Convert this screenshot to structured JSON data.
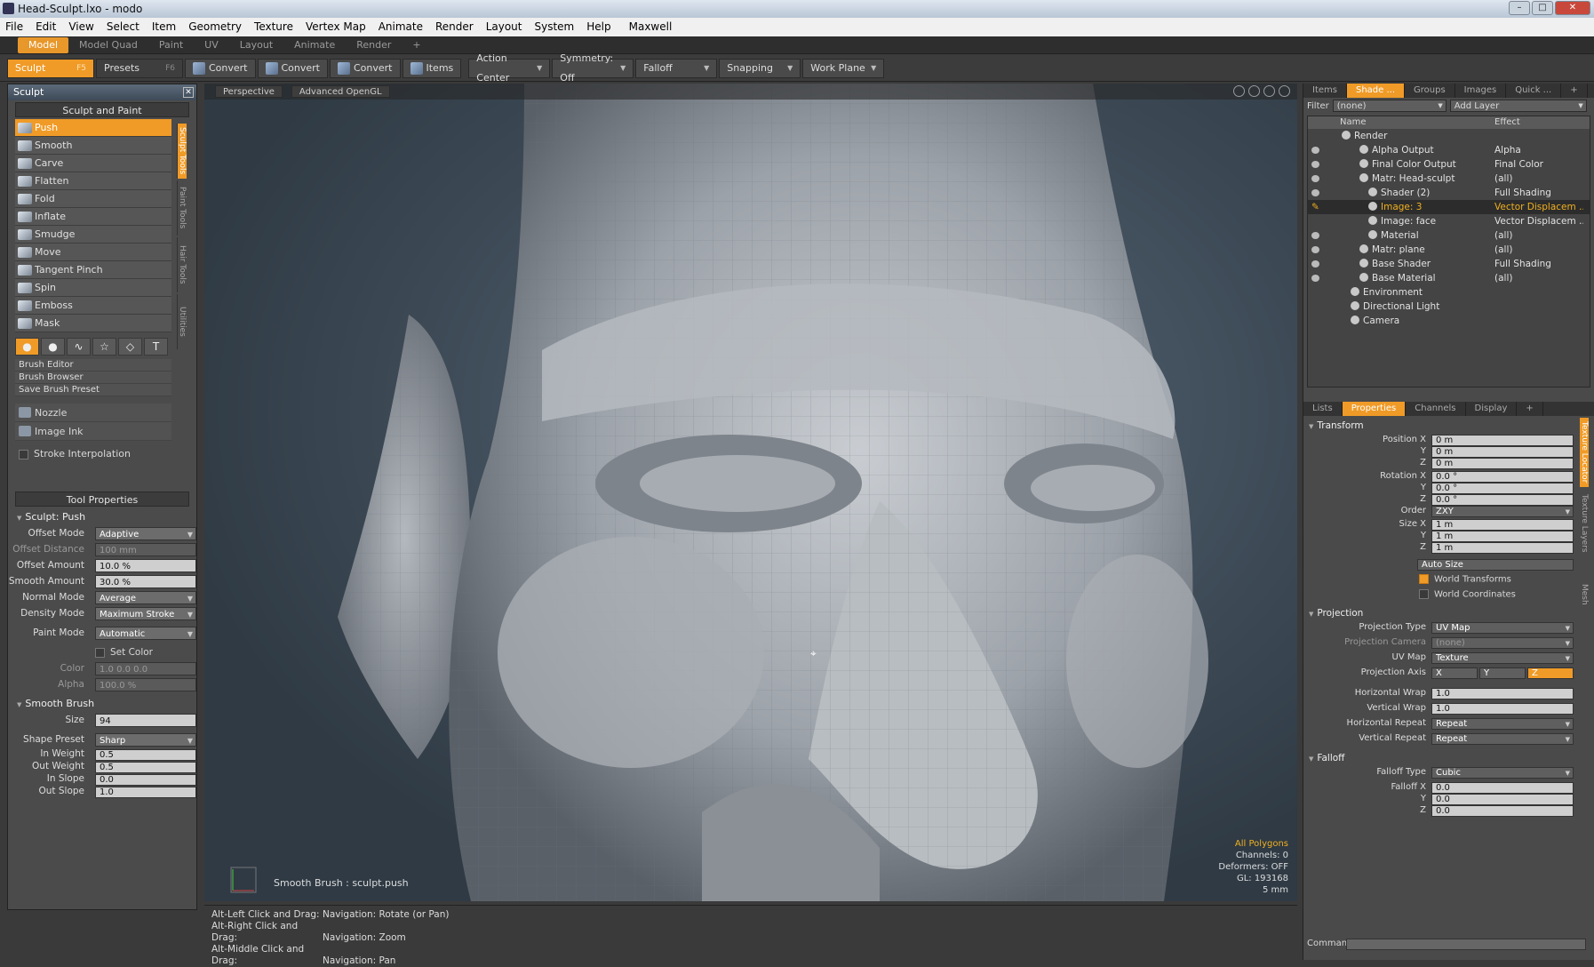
{
  "window": {
    "title": "Head-Sculpt.lxo - modo"
  },
  "menu": [
    "File",
    "Edit",
    "View",
    "Select",
    "Item",
    "Geometry",
    "Texture",
    "Vertex Map",
    "Animate",
    "Render",
    "Layout",
    "System",
    "Help",
    "Maxwell"
  ],
  "layout_tabs": [
    "Model",
    "Model Quad",
    "Paint",
    "UV",
    "Layout",
    "Animate",
    "Render",
    "+"
  ],
  "toolbar": {
    "sculpt": "Sculpt",
    "sculpt_key": "F5",
    "presets": "Presets",
    "presets_key": "F6",
    "convert1": "Convert",
    "convert2": "Convert",
    "convert3": "Convert",
    "items": "Items",
    "action_center": "Action Center",
    "symmetry": "Symmetry: Off",
    "falloff": "Falloff",
    "snapping": "Snapping",
    "work_plane": "Work Plane"
  },
  "left": {
    "panel_title": "Sculpt",
    "section": "Sculpt and Paint",
    "tools": [
      "Push",
      "Smooth",
      "Carve",
      "Flatten",
      "Fold",
      "Inflate",
      "Smudge",
      "Move",
      "Tangent Pinch",
      "Spin",
      "Emboss",
      "Mask"
    ],
    "vtabs": [
      "Sculpt Tools",
      "Paint Tools",
      "Hair Tools",
      "Utilities"
    ],
    "brush_links": [
      "Brush Editor",
      "Brush Browser",
      "Save Brush Preset"
    ],
    "extra": [
      "Nozzle",
      "Image Ink"
    ],
    "stroke_interp": "Stroke Interpolation",
    "tool_props_title": "Tool Properties",
    "sculpt_push": "Sculpt: Push",
    "props": [
      {
        "label": "Offset Mode",
        "value": "Adaptive"
      },
      {
        "label": "Offset Distance",
        "value": "100 mm"
      },
      {
        "label": "Offset Amount",
        "value": "10.0 %"
      },
      {
        "label": "Smooth Amount",
        "value": "30.0 %"
      },
      {
        "label": "Normal Mode",
        "value": "Average"
      },
      {
        "label": "Density Mode",
        "value": "Maximum Stroke"
      },
      {
        "label": "Paint Mode",
        "value": "Automatic"
      }
    ],
    "set_color": "Set Color",
    "color_label": "Color",
    "color_value": "1.0     0.0     0.0",
    "alpha_label": "Alpha",
    "alpha_value": "100.0 %",
    "smooth_brush": "Smooth Brush",
    "size_label": "Size",
    "size_value": "94",
    "shape": [
      {
        "label": "Shape Preset",
        "value": "Sharp"
      },
      {
        "label": "In Weight",
        "value": "0.5"
      },
      {
        "label": "Out Weight",
        "value": "0.5"
      },
      {
        "label": "In Slope",
        "value": "0.0"
      },
      {
        "label": "Out Slope",
        "value": "1.0"
      }
    ]
  },
  "viewport": {
    "view": "Perspective",
    "render": "Advanced OpenGL",
    "status": "Smooth Brush : sculpt.push",
    "overlay": [
      "All Polygons",
      "Channels: 0",
      "Deformers: OFF",
      "GL: 193168",
      "5 mm"
    ]
  },
  "hints": [
    {
      "key": "Alt-Left Click and Drag:",
      "action": "Navigation: Rotate (or Pan)"
    },
    {
      "key": "Alt-Right Click and Drag:",
      "action": "Navigation: Zoom"
    },
    {
      "key": "Alt-Middle Click and Drag:",
      "action": "Navigation: Pan"
    }
  ],
  "right": {
    "tabs": [
      "Items",
      "Shade ...",
      "Groups",
      "Images",
      "Quick ...",
      "+"
    ],
    "filter_label": "Filter",
    "filter_value": "(none)",
    "add_layer": "Add Layer",
    "col_name": "Name",
    "col_effect": "Effect",
    "shader_rows": [
      {
        "name": "Render",
        "effect": ""
      },
      {
        "name": "Alpha Output",
        "effect": "Alpha"
      },
      {
        "name": "Final Color Output",
        "effect": "Final Color"
      },
      {
        "name": "Matr: Head-sculpt",
        "effect": "(all)"
      },
      {
        "name": "Shader (2)",
        "effect": "Full Shading"
      },
      {
        "name": "Image: 3",
        "effect": "Vector Displacem ..."
      },
      {
        "name": "Image: face",
        "effect": "Vector Displacem ..."
      },
      {
        "name": "Material",
        "effect": "(all)"
      },
      {
        "name": "Matr: plane",
        "effect": "(all)"
      },
      {
        "name": "Base Shader",
        "effect": "Full Shading"
      },
      {
        "name": "Base Material",
        "effect": "(all)"
      },
      {
        "name": "Environment",
        "effect": ""
      },
      {
        "name": "Directional Light",
        "effect": ""
      },
      {
        "name": "Camera",
        "effect": ""
      }
    ],
    "tabs2": [
      "Lists",
      "Properties",
      "Channels",
      "Display",
      "+"
    ],
    "transform": "Transform",
    "tprops": [
      {
        "label": "Position X",
        "value": "0 m"
      },
      {
        "label": "Y",
        "value": "0 m"
      },
      {
        "label": "Z",
        "value": "0 m"
      },
      {
        "label": "Rotation X",
        "value": "0.0 °"
      },
      {
        "label": "Y",
        "value": "0.0 °"
      },
      {
        "label": "Z",
        "value": "0.0 °"
      },
      {
        "label": "Order",
        "value": "ZXY"
      },
      {
        "label": "Size X",
        "value": "1 m"
      },
      {
        "label": "Y",
        "value": "1 m"
      },
      {
        "label": "Z",
        "value": "1 m"
      }
    ],
    "auto_size": "Auto Size",
    "world_transforms": "World Transforms",
    "world_coords": "World Coordinates",
    "projection": "Projection",
    "pprops": [
      {
        "label": "Projection Type",
        "value": "UV Map"
      },
      {
        "label": "Projection Camera",
        "value": "(none)"
      },
      {
        "label": "UV Map",
        "value": "Texture"
      }
    ],
    "proj_axis_label": "Projection Axis",
    "proj_axis": [
      "X",
      "Y",
      "Z"
    ],
    "wprops": [
      {
        "label": "Horizontal Wrap",
        "value": "1.0"
      },
      {
        "label": "Vertical Wrap",
        "value": "1.0"
      },
      {
        "label": "Horizontal Repeat",
        "value": "Repeat"
      },
      {
        "label": "Vertical Repeat",
        "value": "Repeat"
      }
    ],
    "falloff": "Falloff",
    "fprops": [
      {
        "label": "Falloff Type",
        "value": "Cubic"
      },
      {
        "label": "Falloff X",
        "value": "0.0"
      },
      {
        "label": "Y",
        "value": "0.0"
      },
      {
        "label": "Z",
        "value": "0.0"
      }
    ],
    "rvtabs": [
      "Texture Locator",
      "Texture Layers",
      "Mesh"
    ],
    "command": "Command"
  }
}
